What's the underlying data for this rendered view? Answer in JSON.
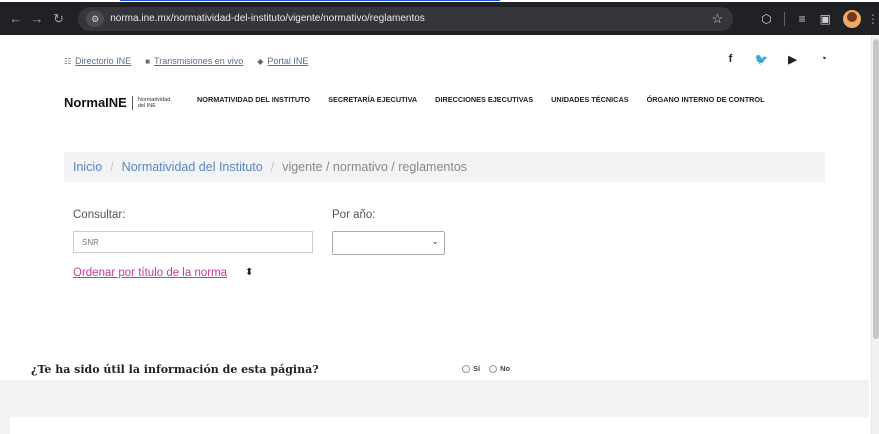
{
  "browser": {
    "url": "norma.ine.mx/normatividad-del-instituto/vigente/normativo/reglamentos"
  },
  "top_links": [
    {
      "icon": "sitemap-icon",
      "glyph": "☷",
      "label": "Directorio INE"
    },
    {
      "icon": "video-icon",
      "glyph": "■",
      "label": "Transmisiones en vivo"
    },
    {
      "icon": "home-icon",
      "glyph": "◆",
      "label": "Portal INE"
    }
  ],
  "social": [
    {
      "icon": "facebook-icon",
      "glyph": "f"
    },
    {
      "icon": "twitter-icon",
      "glyph": "🐦"
    },
    {
      "icon": "youtube-icon",
      "glyph": "▶"
    },
    {
      "icon": "rss-icon",
      "glyph": "◔"
    }
  ],
  "brand": {
    "name": "NormaINE",
    "sub": "Normatividad del INE"
  },
  "menu": [
    "NORMATIVIDAD DEL INSTITUTO",
    "SECRETARÍA EJECUTIVA",
    "DIRECCIONES EJECUTIVAS",
    "UNIDADES TÉCNICAS",
    "ÓRGANO INTERNO DE CONTROL"
  ],
  "breadcrumb": {
    "items": [
      "Inicio",
      "Normatividad del Instituto"
    ],
    "separator": "/",
    "current": "vigente / normativo / reglamentos"
  },
  "filters": {
    "consultar_label": "Consultar:",
    "consultar_placeholder": "SNR",
    "year_label": "Por año:",
    "year_value": ""
  },
  "sort_link": "Ordenar por título de la norma",
  "feedback": {
    "question": "¿Te ha sido útil la información de esta página?",
    "yes": "Sí",
    "no": "No"
  },
  "colors": {
    "accent_link": "#c9389a",
    "breadcrumb_link": "#5b86c5"
  }
}
